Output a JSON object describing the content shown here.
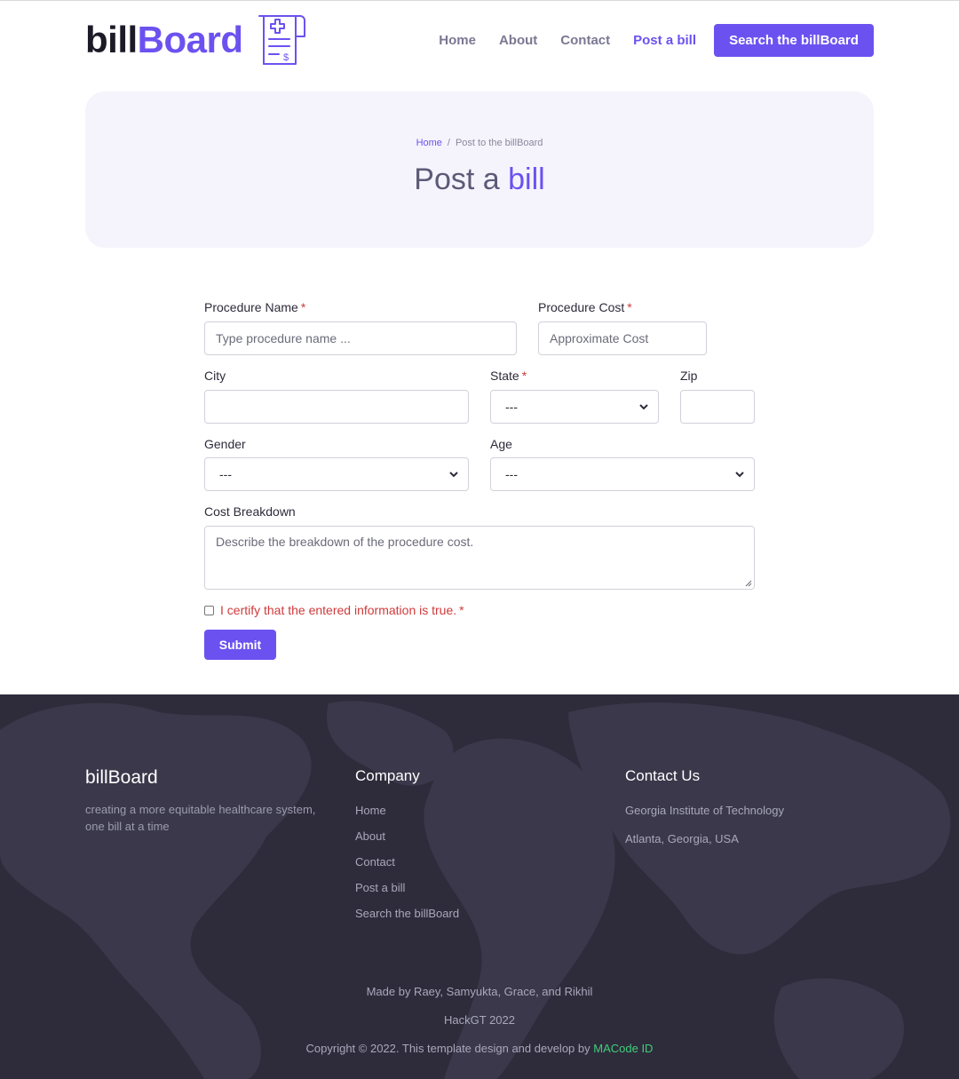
{
  "header": {
    "logo_part1": "bill",
    "logo_part2": "Board",
    "nav": [
      {
        "label": "Home"
      },
      {
        "label": "About"
      },
      {
        "label": "Contact"
      },
      {
        "label": "Post a bill",
        "active": true
      }
    ],
    "cta_label": "Search the billBoard"
  },
  "hero": {
    "breadcrumb_home": "Home",
    "breadcrumb_sep": "/",
    "breadcrumb_current": "Post to the billBoard",
    "title_part1": "Post a ",
    "title_part2": "bill"
  },
  "form": {
    "procedure_name": {
      "label": "Procedure Name",
      "required": "*",
      "placeholder": "Type procedure name ..."
    },
    "procedure_cost": {
      "label": "Procedure Cost",
      "required": "*",
      "placeholder": "Approximate Cost"
    },
    "city": {
      "label": "City",
      "value": ""
    },
    "state": {
      "label": "State",
      "required": "*",
      "selected": "---"
    },
    "zip": {
      "label": "Zip",
      "value": ""
    },
    "gender": {
      "label": "Gender",
      "selected": "---"
    },
    "age": {
      "label": "Age",
      "selected": "---"
    },
    "cost_breakdown": {
      "label": "Cost Breakdown",
      "placeholder": "Describe the breakdown of the procedure cost."
    },
    "certify": {
      "label": "I certify that the entered information is true.",
      "required": "*",
      "checked": false
    },
    "submit_label": "Submit"
  },
  "footer": {
    "brand": "billBoard",
    "tagline": "creating a more equitable healthcare system, one bill at a time",
    "company_heading": "Company",
    "company_links": [
      "Home",
      "About",
      "Contact",
      "Post a bill",
      "Search the billBoard"
    ],
    "contact_heading": "Contact Us",
    "contact_lines": [
      "Georgia Institute of Technology",
      "Atlanta, Georgia, USA"
    ],
    "credits": "Made by Raey, Samyukta, Grace, and Rikhil",
    "event": "HackGT 2022",
    "copyright": "Copyright © 2022. This template design and develop by ",
    "copyright_link": "MACode ID"
  },
  "colors": {
    "accent": "#6b52f0",
    "footer_bg": "#2e2c3b",
    "required": "#d03a3a",
    "credit_link": "#3fce7a"
  }
}
